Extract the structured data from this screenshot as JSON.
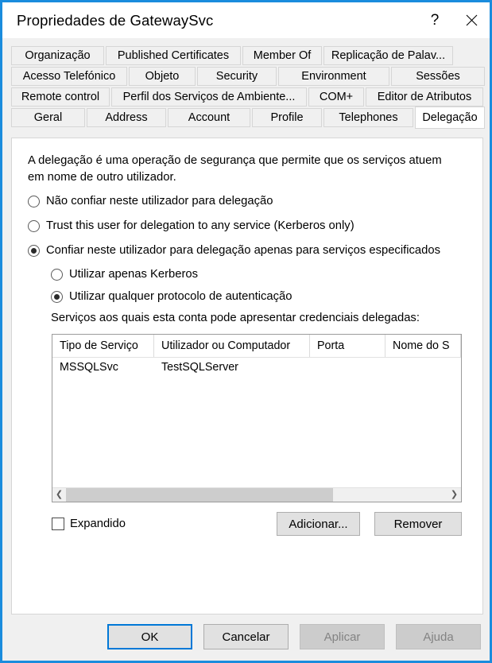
{
  "window": {
    "title": "Propriedades de GatewaySvc",
    "help_glyph": "?",
    "close_glyph": "✕",
    "accent_color": "#1a8cdd"
  },
  "tabs": {
    "rows": [
      [
        "Organização",
        "Published Certificates",
        "Member Of",
        "Replicação de Palav..."
      ],
      [
        "Acesso Telefónico",
        "Objeto",
        "Security",
        "Environment",
        "Sessões"
      ],
      [
        "Remote control",
        "Perfil dos Serviços de Ambiente...",
        "COM+",
        "Editor de Atributos"
      ],
      [
        "Geral",
        "Address",
        "Account",
        "Profile",
        "Telephones",
        "Delegação"
      ]
    ],
    "active": "Delegação"
  },
  "panel": {
    "description": "A delegação é uma operação de segurança que permite que os serviços atuem em nome de outro utilizador.",
    "delegation_options": [
      {
        "label": "Não confiar neste utilizador para delegação",
        "checked": false
      },
      {
        "label": "Trust this user for delegation to any service (Kerberos only)",
        "checked": false
      },
      {
        "label": "Confiar neste utilizador para delegação apenas para serviços especificados",
        "checked": true
      }
    ],
    "protocol_options": [
      {
        "label": "Utilizar apenas Kerberos",
        "checked": false
      },
      {
        "label": "Utilizar qualquer protocolo de autenticação",
        "checked": true
      }
    ],
    "list_caption": "Serviços aos quais esta conta pode apresentar credenciais delegadas:",
    "services_list": {
      "columns": [
        "Tipo de Serviço",
        "Utilizador ou Computador",
        "Porta",
        "Nome do S"
      ],
      "rows": [
        [
          "MSSQLSvc",
          "TestSQLServer",
          "",
          ""
        ]
      ],
      "scroll": {
        "left_arrow": "❮",
        "right_arrow": "❯",
        "thumb_percent": 70
      }
    },
    "expanded_checkbox": {
      "label": "Expandido",
      "checked": false
    },
    "add_button": "Adicionar...",
    "remove_button": "Remover"
  },
  "footer": {
    "ok": "OK",
    "cancel": "Cancelar",
    "apply": "Aplicar",
    "help": "Ajuda",
    "apply_enabled": false,
    "help_enabled": false
  }
}
